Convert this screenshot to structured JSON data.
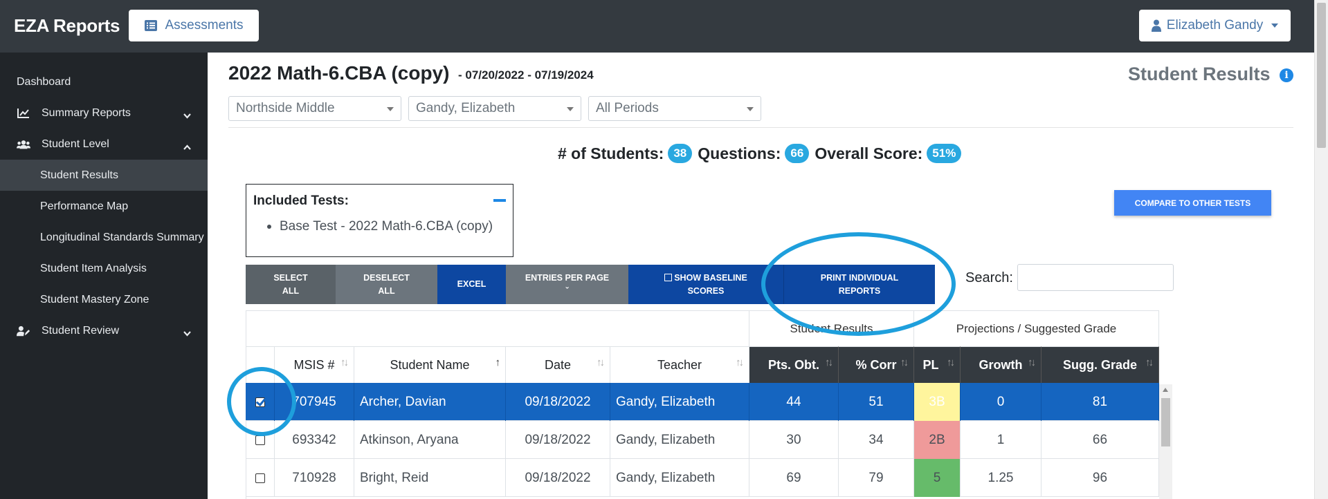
{
  "header": {
    "brand": "EZA Reports",
    "assessments_label": "Assessments",
    "user_label": "Elizabeth Gandy"
  },
  "sidebar": {
    "items": [
      {
        "label": "Dashboard"
      },
      {
        "label": "Summary Reports"
      },
      {
        "label": "Student Level"
      },
      {
        "label": "Student Results"
      },
      {
        "label": "Performance Map"
      },
      {
        "label": "Longitudinal Standards Summary"
      },
      {
        "label": "Student Item Analysis"
      },
      {
        "label": "Student Mastery Zone"
      },
      {
        "label": "Student Review"
      }
    ]
  },
  "main": {
    "title": "2022 Math-6.CBA (copy)",
    "date_range": "- 07/20/2022 - 07/19/2024",
    "results_title": "Student Results",
    "info_icon": "i",
    "filters": {
      "school": "Northside Middle",
      "teacher": "Gandy, Elizabeth",
      "period": "All Periods"
    },
    "stats": {
      "students_label": "# of Students:",
      "students_value": "38",
      "questions_label": "Questions:",
      "questions_value": "66",
      "score_label": "Overall Score:",
      "score_value": "51%"
    },
    "included": {
      "heading": "Included Tests:",
      "item": "Base Test - 2022 Math-6.CBA (copy)"
    },
    "compare_label": "COMPARE TO OTHER TESTS",
    "toolbar": {
      "select_all_1": "SELECT",
      "select_all_2": "ALL",
      "deselect_all_1": "DESELECT",
      "deselect_all_2": "ALL",
      "excel": "EXCEL",
      "entries_1": "ENTRIES PER PAGE",
      "entries_2": "ˇ",
      "baseline_1": "SHOW BASELINE",
      "baseline_2": "SCORES",
      "print_1": "PRINT INDIVIDUAL",
      "print_2": "REPORTS"
    },
    "search_label": "Search:"
  },
  "table": {
    "group_headers": {
      "results": "Student Results",
      "projections": "Projections / Suggested Grade"
    },
    "columns": [
      "MSIS #",
      "Student Name",
      "Date",
      "Teacher",
      "Pts. Obt.",
      "% Corr",
      "PL",
      "Growth",
      "Sugg. Grade"
    ],
    "rows": [
      {
        "msis": "707945",
        "name": "Archer, Davian",
        "date": "09/18/2022",
        "teacher": "Gandy, Elizabeth",
        "pts": "44",
        "corr": "51",
        "pl": "3B",
        "growth": "0",
        "grade": "81"
      },
      {
        "msis": "693342",
        "name": "Atkinson, Aryana",
        "date": "09/18/2022",
        "teacher": "Gandy, Elizabeth",
        "pts": "30",
        "corr": "34",
        "pl": "2B",
        "growth": "1",
        "grade": "66"
      },
      {
        "msis": "710928",
        "name": "Bright, Reid",
        "date": "09/18/2022",
        "teacher": "Gandy, Elizabeth",
        "pts": "69",
        "corr": "79",
        "pl": "5",
        "growth": "1.25",
        "grade": "96"
      }
    ]
  },
  "colors": {
    "topbar": "#343a40",
    "sidebar": "#212529",
    "selected_row": "#1565c0",
    "toolbar_blue": "#0d47a1",
    "pl_3b": "#fff59d",
    "pl_2b": "#ef9a9a",
    "pl_5": "#66bb6a",
    "annotation": "#1e9fdc"
  }
}
